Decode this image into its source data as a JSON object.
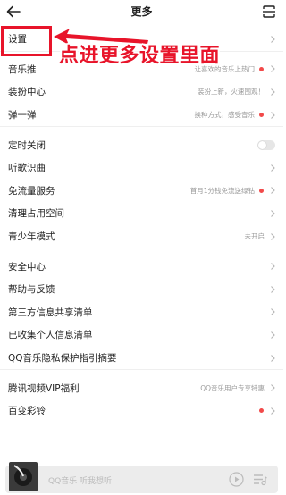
{
  "header": {
    "title": "更多"
  },
  "annotation": {
    "text": "点进更多设置里面"
  },
  "groups": [
    [
      {
        "label": "设置",
        "sub": "",
        "dot": false,
        "toggle": false
      }
    ],
    [
      {
        "label": "音乐推",
        "sub": "让喜欢的音乐上热门",
        "dot": true,
        "toggle": false
      },
      {
        "label": "装扮中心",
        "sub": "装扮上新，火速围观！",
        "dot": false,
        "toggle": false
      },
      {
        "label": "弹一弹",
        "sub": "换种方式，感受音乐",
        "dot": true,
        "toggle": false
      }
    ],
    [
      {
        "label": "定时关闭",
        "sub": "",
        "dot": false,
        "toggle": true
      },
      {
        "label": "听歌识曲",
        "sub": "",
        "dot": false,
        "toggle": false
      },
      {
        "label": "免流量服务",
        "sub": "首月1分钱免流送绿钻",
        "dot": true,
        "toggle": false
      },
      {
        "label": "清理占用空间",
        "sub": "",
        "dot": false,
        "toggle": false
      },
      {
        "label": "青少年模式",
        "sub": "未开启",
        "dot": false,
        "toggle": false
      }
    ],
    [
      {
        "label": "安全中心",
        "sub": "",
        "dot": false,
        "toggle": false
      },
      {
        "label": "帮助与反馈",
        "sub": "",
        "dot": false,
        "toggle": false
      },
      {
        "label": "第三方信息共享清单",
        "sub": "",
        "dot": false,
        "toggle": false
      },
      {
        "label": "已收集个人信息清单",
        "sub": "",
        "dot": false,
        "toggle": false
      },
      {
        "label": "QQ音乐隐私保护指引摘要",
        "sub": "",
        "dot": false,
        "toggle": false
      }
    ],
    [
      {
        "label": "腾讯视频VIP福利",
        "sub": "QQ音乐用户专享特惠",
        "dot": false,
        "toggle": false
      },
      {
        "label": "百变彩铃",
        "sub": "",
        "dot": true,
        "toggle": false
      }
    ]
  ],
  "player": {
    "text": "QQ音乐 听我想听"
  },
  "colors": {
    "accent_red": "#e8142a",
    "dot_red": "#f24949"
  },
  "icons": {
    "back": "arrow-left-icon",
    "scan": "scan-icon",
    "chevron": "chevron-right-icon",
    "play": "play-icon",
    "queue": "playlist-icon"
  }
}
